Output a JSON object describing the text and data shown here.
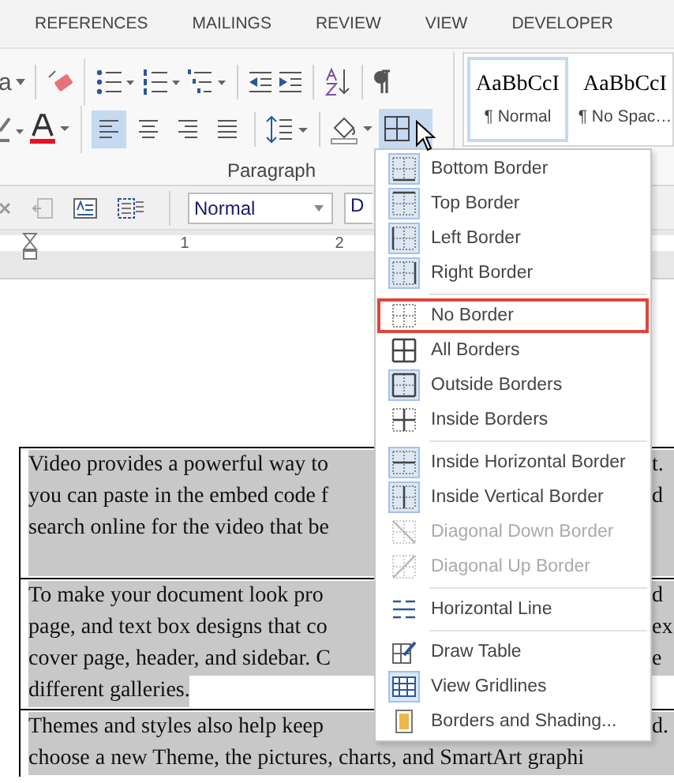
{
  "tabs": [
    "REFERENCES",
    "MAILINGS",
    "REVIEW",
    "VIEW",
    "DEVELOPER"
  ],
  "ribbon": {
    "change_case": "a",
    "group_label": "Paragraph",
    "align": [
      {
        "kind": "left",
        "selected": true
      },
      {
        "kind": "center",
        "selected": false
      },
      {
        "kind": "right",
        "selected": false
      },
      {
        "kind": "justify",
        "selected": false
      }
    ],
    "borders_button": {
      "selected": true
    },
    "styles": [
      {
        "sample": "AaBbCcI",
        "name": "¶ Normal",
        "selected": true
      },
      {
        "sample": "AaBbCcI",
        "name": "¶ No Spac…",
        "selected": false
      }
    ]
  },
  "toolbar": {
    "style": "Normal",
    "font": "D"
  },
  "ruler": {
    "marks": [
      "1",
      "2"
    ]
  },
  "document": {
    "rows": [
      {
        "lines": [
          {
            "left": "Video provides a powerful way to",
            "right": "t.",
            "shaded": true
          },
          {
            "left": "you can paste in the embed code f",
            "right": "d",
            "shaded": true
          },
          {
            "left": "search online for the video that be",
            "shaded": true
          },
          {
            "shaded": true
          }
        ]
      },
      {
        "lines": [
          {
            "left": "To make your document look pro",
            "right": "d",
            "shaded": true
          },
          {
            "left": "page, and text box designs that co",
            "right": "ex",
            "shaded": true
          },
          {
            "left": "cover page, header, and sidebar. C",
            "right": "e",
            "shaded": true
          },
          {
            "left": "different galleries.",
            "shaded": false
          }
        ]
      },
      {
        "lines": [
          {
            "left": "Themes and styles also help keep",
            "right": "d.",
            "shaded": true
          },
          {
            "left": "choose a new Theme, the pictures, charts, and SmartArt graphi",
            "shaded": true
          }
        ]
      }
    ]
  },
  "border_menu": {
    "items": [
      {
        "label": "Bottom Border",
        "kind": "bottom",
        "selected": true,
        "disabled": false,
        "annotated": false
      },
      {
        "label": "Top Border",
        "kind": "top",
        "selected": true,
        "disabled": false,
        "annotated": false
      },
      {
        "label": "Left Border",
        "kind": "left",
        "selected": true,
        "disabled": false,
        "annotated": false
      },
      {
        "label": "Right Border",
        "kind": "right",
        "selected": true,
        "disabled": false,
        "annotated": false,
        "divider_after": true
      },
      {
        "label": "No Border",
        "kind": "none",
        "selected": false,
        "disabled": false,
        "annotated": true
      },
      {
        "label": "All Borders",
        "kind": "all",
        "selected": false,
        "disabled": false,
        "annotated": false
      },
      {
        "label": "Outside Borders",
        "kind": "outside",
        "selected": true,
        "disabled": false,
        "annotated": false
      },
      {
        "label": "Inside Borders",
        "kind": "inside",
        "selected": false,
        "disabled": false,
        "annotated": false,
        "divider_after": true
      },
      {
        "label": "Inside Horizontal Border",
        "kind": "inside-h",
        "selected": true,
        "disabled": false,
        "annotated": false
      },
      {
        "label": "Inside Vertical Border",
        "kind": "inside-v",
        "selected": true,
        "disabled": false,
        "annotated": false
      },
      {
        "label": "Diagonal Down Border",
        "kind": "diag-down",
        "selected": false,
        "disabled": true,
        "annotated": false
      },
      {
        "label": "Diagonal Up Border",
        "kind": "diag-up",
        "selected": false,
        "disabled": true,
        "annotated": false,
        "divider_after": true
      },
      {
        "label": "Horizontal Line",
        "kind": "hline",
        "selected": false,
        "disabled": false,
        "annotated": false,
        "divider_after": true
      },
      {
        "label": "Draw Table",
        "kind": "draw-table",
        "selected": false,
        "disabled": false,
        "annotated": false
      },
      {
        "label": "View Gridlines",
        "kind": "gridlines",
        "selected": true,
        "disabled": false,
        "annotated": false
      },
      {
        "label": "Borders and Shading...",
        "kind": "shading",
        "selected": false,
        "disabled": false,
        "annotated": false
      }
    ]
  }
}
